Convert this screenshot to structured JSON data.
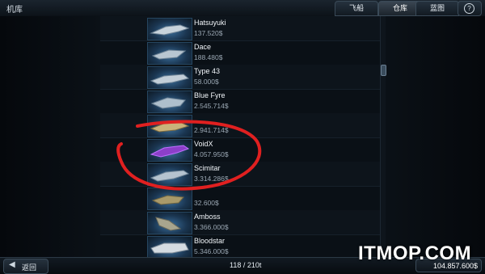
{
  "header": {
    "title": "机库",
    "tabs": [
      {
        "label": "飞船"
      },
      {
        "label": "仓库"
      },
      {
        "label": "蓝图"
      }
    ],
    "help_symbol": "?"
  },
  "ships": [
    {
      "name": "Hatsuyuki",
      "price": "137.520$"
    },
    {
      "name": "Dace",
      "price": "188.480$"
    },
    {
      "name": "Type 43",
      "price": "58.000$"
    },
    {
      "name": "Blue Fyre",
      "price": "2.545.714$"
    },
    {
      "name": "",
      "price": "2.941.714$"
    },
    {
      "name": "VoidX",
      "price": "4.057.950$"
    },
    {
      "name": "Scimitar",
      "price": "3.314.286$"
    },
    {
      "name": "",
      "price": "32.600$"
    },
    {
      "name": "Amboss",
      "price": "3.366.000$"
    },
    {
      "name": "Bloodstar",
      "price": "5.346.000$"
    }
  ],
  "footer": {
    "back_arrow": "◀",
    "back_label": "返回",
    "capacity": "118 / 210t",
    "money": "104.857.600$"
  },
  "watermark": "ITMOP.COM",
  "colors": {
    "annotation": "#e02020",
    "accent": "#3b6f9c",
    "background": "#05080c"
  },
  "icons": [
    "help-icon",
    "back-arrow-icon",
    "ship-icon"
  ]
}
